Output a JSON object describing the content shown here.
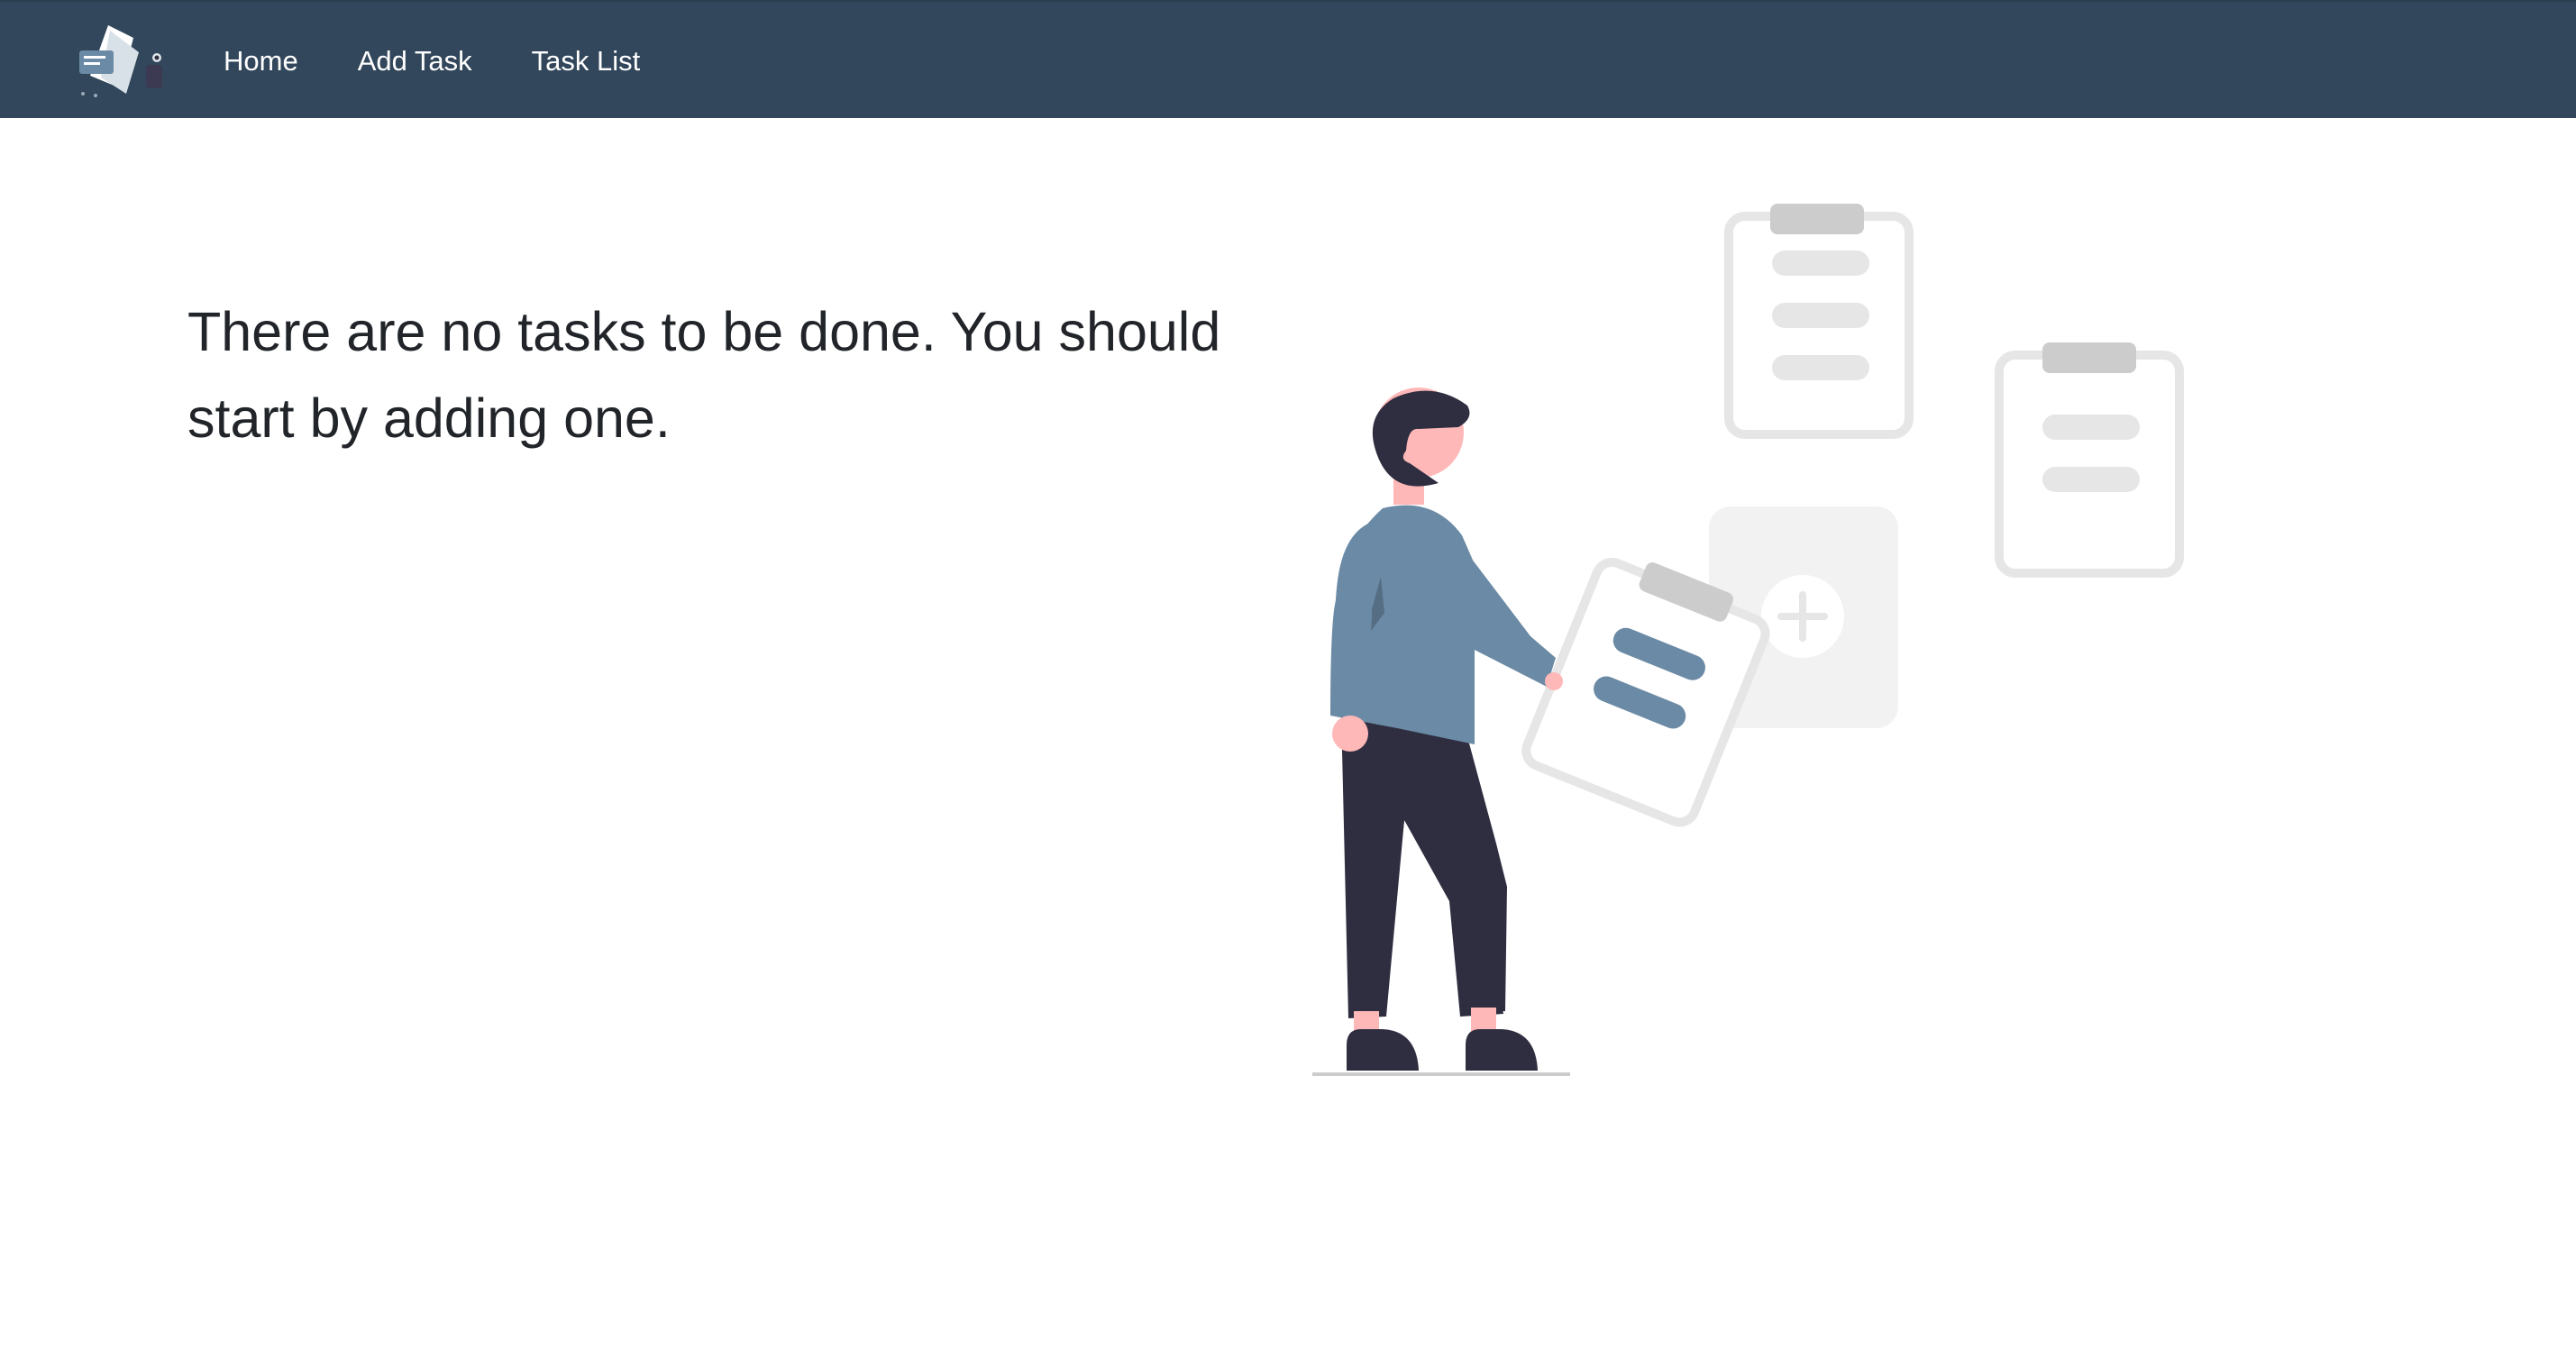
{
  "navbar": {
    "brand_icon": "task-clipboard-logo",
    "links": [
      {
        "label": "Home"
      },
      {
        "label": "Add Task"
      },
      {
        "label": "Task List"
      }
    ]
  },
  "main": {
    "empty_message": "There are no tasks to be done. You should start by adding one.",
    "illustration": "person-holding-clipboard-illustration"
  },
  "colors": {
    "navbar_bg": "#32475b",
    "accent": "#6b8aa5",
    "text": "#212529"
  }
}
